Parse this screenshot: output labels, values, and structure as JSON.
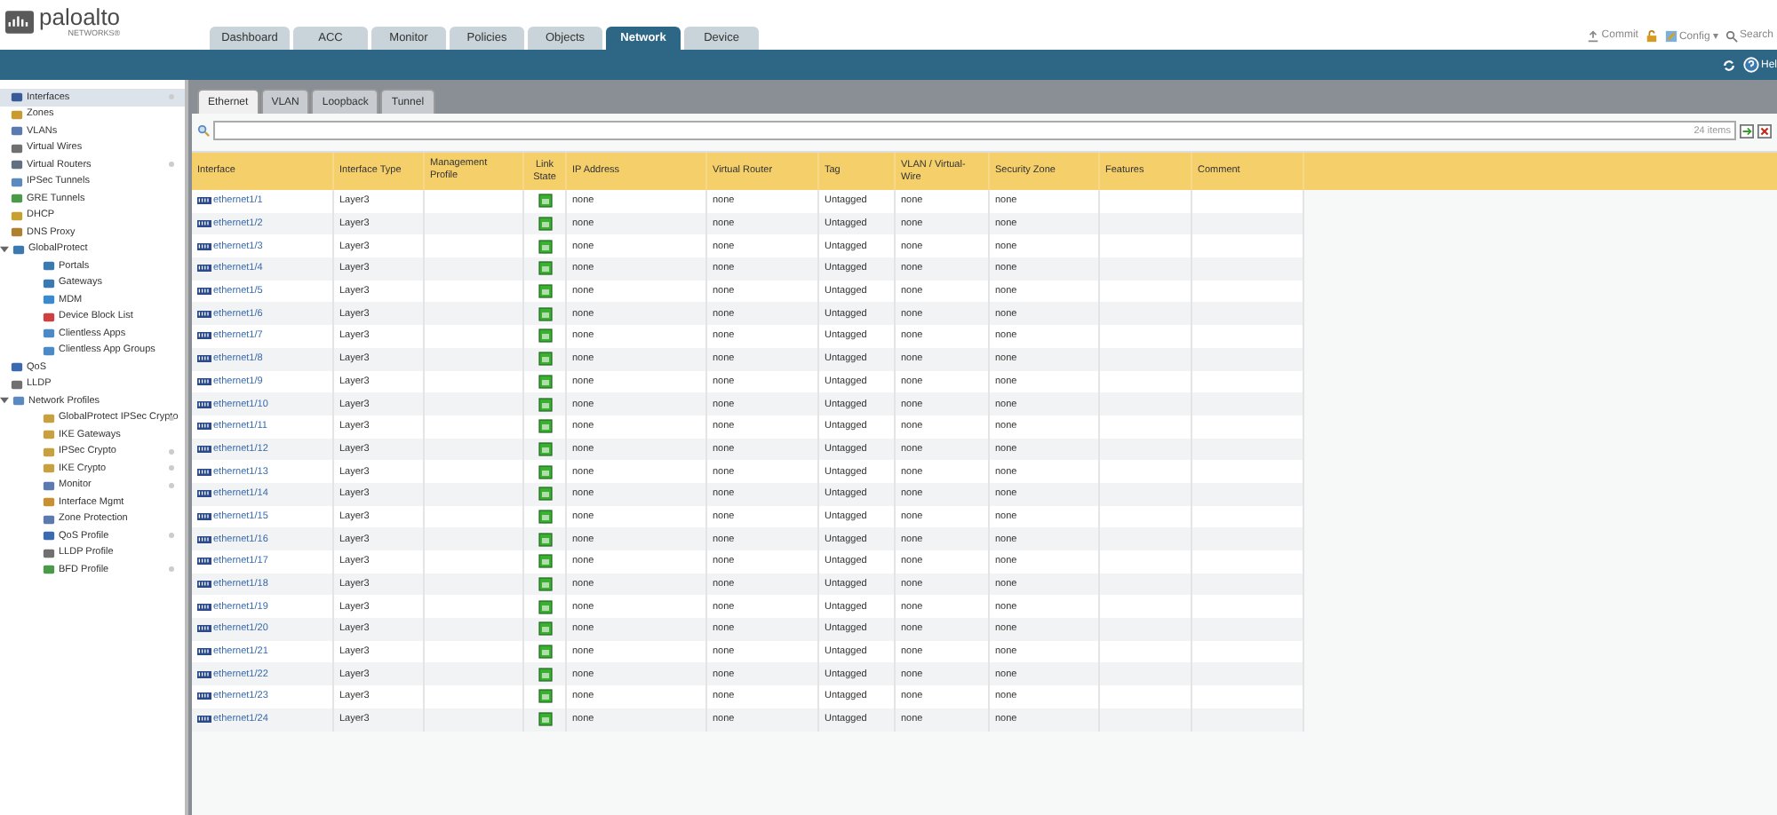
{
  "header": {
    "logo": "paloalto",
    "logo_sub": "NETWORKS®",
    "actions": [
      {
        "label": "Commit",
        "kind": "commit"
      },
      {
        "kind": "lock"
      },
      {
        "label": "Config ▾",
        "kind": "config"
      },
      {
        "label": "Search",
        "kind": "search"
      }
    ]
  },
  "main_tabs": [
    {
      "label": "Dashboard",
      "selected": false
    },
    {
      "label": "ACC",
      "selected": false
    },
    {
      "label": "Monitor",
      "selected": false
    },
    {
      "label": "Policies",
      "selected": false
    },
    {
      "label": "Objects",
      "selected": false
    },
    {
      "label": "Network",
      "selected": true
    },
    {
      "label": "Device",
      "selected": false
    }
  ],
  "toolbar": {
    "help": "Hel"
  },
  "sidebar": {
    "items": [
      {
        "label": "Interfaces",
        "selected": true,
        "indicator": true,
        "color": "#3a5a9a"
      },
      {
        "label": "Zones",
        "selected": false,
        "indicator": false,
        "color": "#c89a30"
      },
      {
        "label": "VLANs",
        "selected": false,
        "indicator": false,
        "color": "#5a7ab0"
      },
      {
        "label": "Virtual Wires",
        "selected": false,
        "indicator": false,
        "color": "#707070"
      },
      {
        "label": "Virtual Routers",
        "selected": false,
        "indicator": true,
        "color": "#607080"
      },
      {
        "label": "IPSec Tunnels",
        "selected": false,
        "indicator": false,
        "color": "#5a8ac0"
      },
      {
        "label": "GRE Tunnels",
        "selected": false,
        "indicator": false,
        "color": "#4a9a4a"
      },
      {
        "label": "DHCP",
        "selected": false,
        "indicator": false,
        "color": "#c8a030"
      },
      {
        "label": "DNS Proxy",
        "selected": false,
        "indicator": false,
        "color": "#b08030"
      },
      {
        "label": "GlobalProtect",
        "selected": false,
        "indicator": false,
        "color": "#3a7ab0",
        "expanded": true,
        "children": [
          {
            "label": "Portals",
            "selected": false,
            "indicator": false,
            "color": "#3a7ab0"
          },
          {
            "label": "Gateways",
            "selected": false,
            "indicator": false,
            "color": "#3a7ab0"
          },
          {
            "label": "MDM",
            "selected": false,
            "indicator": false,
            "color": "#3a8ad0"
          },
          {
            "label": "Device Block List",
            "selected": false,
            "indicator": false,
            "color": "#d04040"
          },
          {
            "label": "Clientless Apps",
            "selected": false,
            "indicator": false,
            "color": "#4a8ac8"
          },
          {
            "label": "Clientless App Groups",
            "selected": false,
            "indicator": false,
            "color": "#4a8ac8"
          }
        ]
      },
      {
        "label": "QoS",
        "selected": false,
        "indicator": false,
        "color": "#3a6ab0"
      },
      {
        "label": "LLDP",
        "selected": false,
        "indicator": false,
        "color": "#707070"
      },
      {
        "label": "Network Profiles",
        "selected": false,
        "indicator": false,
        "color": "#5a8ac0",
        "expanded": true,
        "children": [
          {
            "label": "GlobalProtect IPSec Crypto",
            "selected": false,
            "indicator": true,
            "color": "#c8a040"
          },
          {
            "label": "IKE Gateways",
            "selected": false,
            "indicator": false,
            "color": "#c8a040"
          },
          {
            "label": "IPSec Crypto",
            "selected": false,
            "indicator": true,
            "color": "#c8a040"
          },
          {
            "label": "IKE Crypto",
            "selected": false,
            "indicator": true,
            "color": "#c8a040"
          },
          {
            "label": "Monitor",
            "selected": false,
            "indicator": true,
            "color": "#5a7ab0"
          },
          {
            "label": "Interface Mgmt",
            "selected": false,
            "indicator": false,
            "color": "#c89030"
          },
          {
            "label": "Zone Protection",
            "selected": false,
            "indicator": false,
            "color": "#5a7ab0"
          },
          {
            "label": "QoS Profile",
            "selected": false,
            "indicator": true,
            "color": "#3a6ab0"
          },
          {
            "label": "LLDP Profile",
            "selected": false,
            "indicator": false,
            "color": "#707070"
          },
          {
            "label": "BFD Profile",
            "selected": false,
            "indicator": true,
            "color": "#4a9a4a"
          }
        ]
      }
    ]
  },
  "sub_tabs": [
    {
      "label": "Ethernet",
      "selected": true
    },
    {
      "label": "VLAN",
      "selected": false
    },
    {
      "label": "Loopback",
      "selected": false
    },
    {
      "label": "Tunnel",
      "selected": false
    }
  ],
  "filter": {
    "count": "24 items"
  },
  "table": {
    "columns": [
      "Interface",
      "Interface Type",
      "Management Profile",
      "Link State",
      "IP Address",
      "Virtual Router",
      "Tag",
      "VLAN / Virtual-Wire",
      "Security Zone",
      "Features",
      "Comment"
    ],
    "rows": [
      {
        "interface": "ethernet1/1",
        "type": "Layer3",
        "link_up": true,
        "ip": "none",
        "router": "none",
        "tag": "Untagged",
        "vlan": "none",
        "zone": "none"
      },
      {
        "interface": "ethernet1/2",
        "type": "Layer3",
        "link_up": true,
        "ip": "none",
        "router": "none",
        "tag": "Untagged",
        "vlan": "none",
        "zone": "none"
      },
      {
        "interface": "ethernet1/3",
        "type": "Layer3",
        "link_up": true,
        "ip": "none",
        "router": "none",
        "tag": "Untagged",
        "vlan": "none",
        "zone": "none"
      },
      {
        "interface": "ethernet1/4",
        "type": "Layer3",
        "link_up": true,
        "ip": "none",
        "router": "none",
        "tag": "Untagged",
        "vlan": "none",
        "zone": "none"
      },
      {
        "interface": "ethernet1/5",
        "type": "Layer3",
        "link_up": true,
        "ip": "none",
        "router": "none",
        "tag": "Untagged",
        "vlan": "none",
        "zone": "none"
      },
      {
        "interface": "ethernet1/6",
        "type": "Layer3",
        "link_up": true,
        "ip": "none",
        "router": "none",
        "tag": "Untagged",
        "vlan": "none",
        "zone": "none"
      },
      {
        "interface": "ethernet1/7",
        "type": "Layer3",
        "link_up": true,
        "ip": "none",
        "router": "none",
        "tag": "Untagged",
        "vlan": "none",
        "zone": "none"
      },
      {
        "interface": "ethernet1/8",
        "type": "Layer3",
        "link_up": true,
        "ip": "none",
        "router": "none",
        "tag": "Untagged",
        "vlan": "none",
        "zone": "none"
      },
      {
        "interface": "ethernet1/9",
        "type": "Layer3",
        "link_up": true,
        "ip": "none",
        "router": "none",
        "tag": "Untagged",
        "vlan": "none",
        "zone": "none"
      },
      {
        "interface": "ethernet1/10",
        "type": "Layer3",
        "link_up": true,
        "ip": "none",
        "router": "none",
        "tag": "Untagged",
        "vlan": "none",
        "zone": "none"
      },
      {
        "interface": "ethernet1/11",
        "type": "Layer3",
        "link_up": true,
        "ip": "none",
        "router": "none",
        "tag": "Untagged",
        "vlan": "none",
        "zone": "none"
      },
      {
        "interface": "ethernet1/12",
        "type": "Layer3",
        "link_up": true,
        "ip": "none",
        "router": "none",
        "tag": "Untagged",
        "vlan": "none",
        "zone": "none"
      },
      {
        "interface": "ethernet1/13",
        "type": "Layer3",
        "link_up": true,
        "ip": "none",
        "router": "none",
        "tag": "Untagged",
        "vlan": "none",
        "zone": "none"
      },
      {
        "interface": "ethernet1/14",
        "type": "Layer3",
        "link_up": true,
        "ip": "none",
        "router": "none",
        "tag": "Untagged",
        "vlan": "none",
        "zone": "none"
      },
      {
        "interface": "ethernet1/15",
        "type": "Layer3",
        "link_up": true,
        "ip": "none",
        "router": "none",
        "tag": "Untagged",
        "vlan": "none",
        "zone": "none"
      },
      {
        "interface": "ethernet1/16",
        "type": "Layer3",
        "link_up": true,
        "ip": "none",
        "router": "none",
        "tag": "Untagged",
        "vlan": "none",
        "zone": "none"
      },
      {
        "interface": "ethernet1/17",
        "type": "Layer3",
        "link_up": true,
        "ip": "none",
        "router": "none",
        "tag": "Untagged",
        "vlan": "none",
        "zone": "none"
      },
      {
        "interface": "ethernet1/18",
        "type": "Layer3",
        "link_up": true,
        "ip": "none",
        "router": "none",
        "tag": "Untagged",
        "vlan": "none",
        "zone": "none"
      },
      {
        "interface": "ethernet1/19",
        "type": "Layer3",
        "link_up": true,
        "ip": "none",
        "router": "none",
        "tag": "Untagged",
        "vlan": "none",
        "zone": "none"
      },
      {
        "interface": "ethernet1/20",
        "type": "Layer3",
        "link_up": true,
        "ip": "none",
        "router": "none",
        "tag": "Untagged",
        "vlan": "none",
        "zone": "none"
      },
      {
        "interface": "ethernet1/21",
        "type": "Layer3",
        "link_up": true,
        "ip": "none",
        "router": "none",
        "tag": "Untagged",
        "vlan": "none",
        "zone": "none"
      },
      {
        "interface": "ethernet1/22",
        "type": "Layer3",
        "link_up": true,
        "ip": "none",
        "router": "none",
        "tag": "Untagged",
        "vlan": "none",
        "zone": "none"
      },
      {
        "interface": "ethernet1/23",
        "type": "Layer3",
        "link_up": true,
        "ip": "none",
        "router": "none",
        "tag": "Untagged",
        "vlan": "none",
        "zone": "none"
      },
      {
        "interface": "ethernet1/24",
        "type": "Layer3",
        "link_up": true,
        "ip": "none",
        "router": "none",
        "tag": "Untagged",
        "vlan": "none",
        "zone": "none"
      }
    ]
  }
}
